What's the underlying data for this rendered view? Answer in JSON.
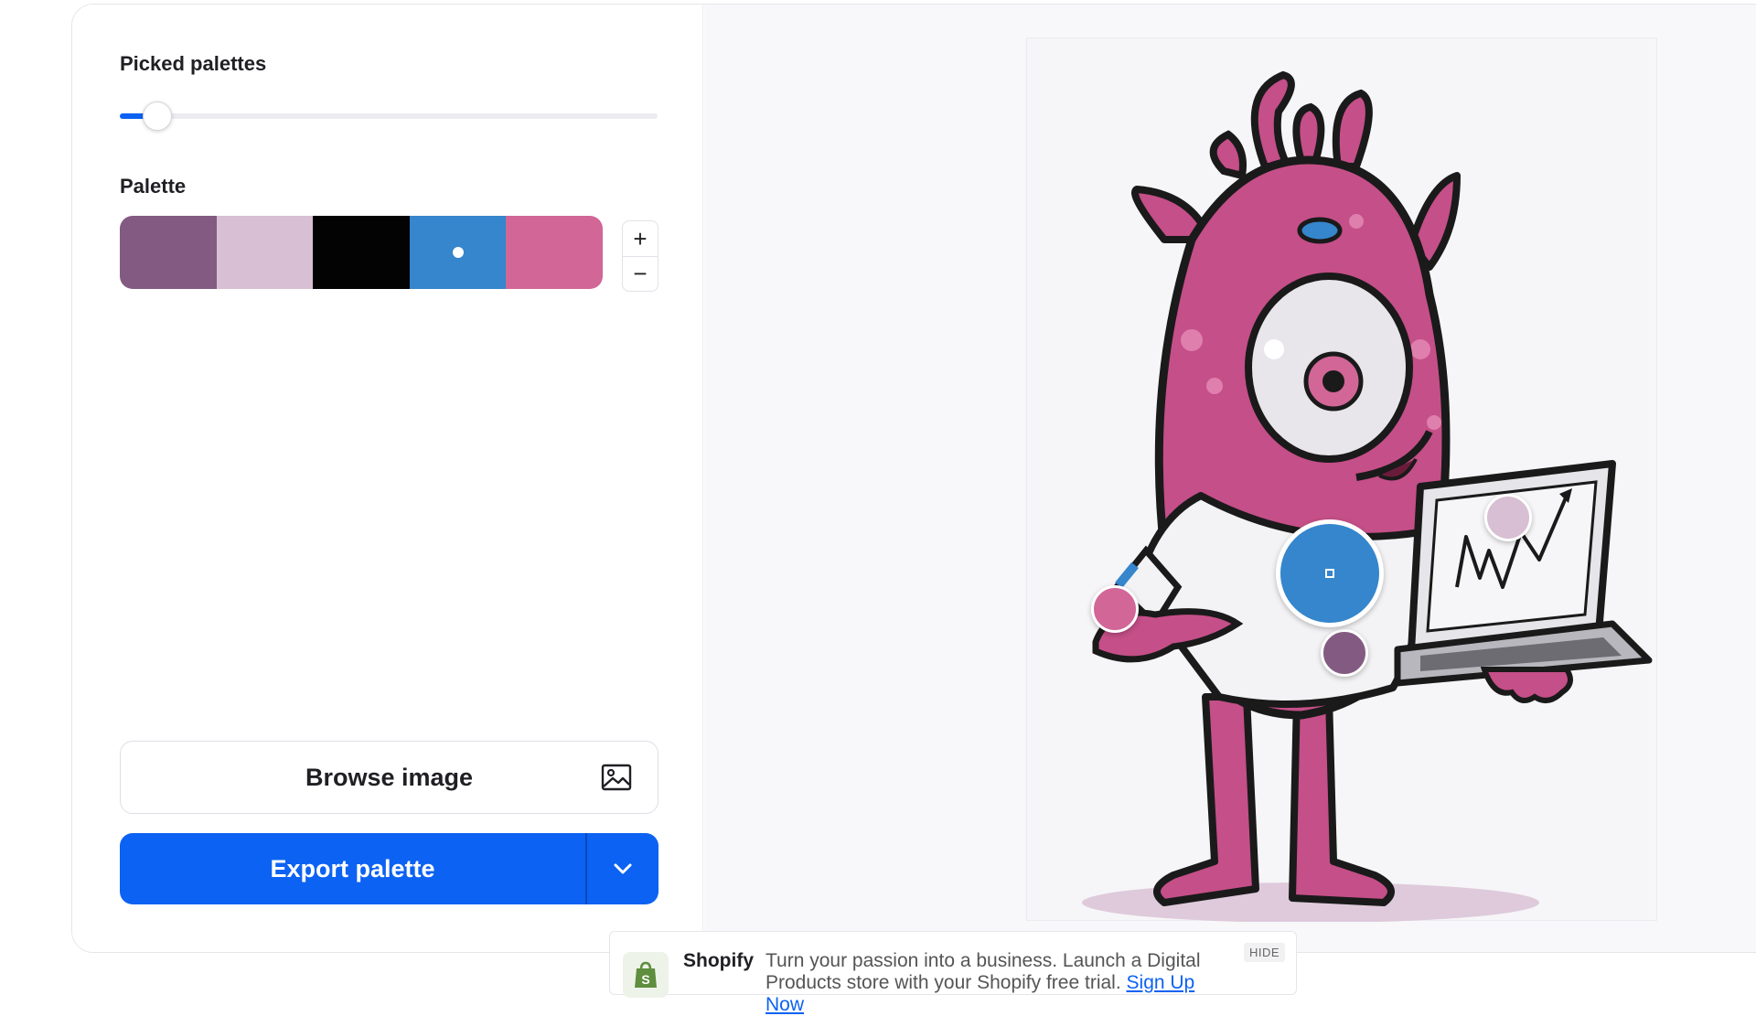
{
  "controls": {
    "picked_label": "Picked palettes",
    "picked_slider_value": 0.07,
    "palette_label": "Palette",
    "palette": [
      {
        "color": "#835b82",
        "selected": false
      },
      {
        "color": "#d8bfd3",
        "selected": false
      },
      {
        "color": "#030303",
        "selected": false
      },
      {
        "color": "#3586cc",
        "selected": true
      },
      {
        "color": "#d16697",
        "selected": false
      }
    ],
    "plus_label": "+",
    "minus_label": "−",
    "browse_label": "Browse image",
    "browse_icon": "image-icon",
    "export_label": "Export palette",
    "export_dropdown_icon": "chevron-down-icon"
  },
  "preview": {
    "image_subject": "pink one-eyed monster holding a laptop",
    "picker_icon": "color-picker-marker"
  },
  "ad": {
    "brand": "Shopify",
    "text": "Turn your passion into a business. Launch a Digital Products store with your Shopify free trial.",
    "link": "Sign Up Now",
    "hide": "HIDE",
    "logo_icon": "shopify-bag-icon"
  },
  "colors": {
    "accent": "#0c62f2",
    "canvas_bg": "#f8f7fa"
  }
}
